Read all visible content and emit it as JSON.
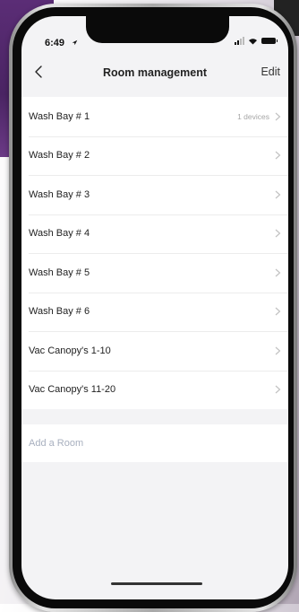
{
  "status_bar": {
    "time": "6:49"
  },
  "nav": {
    "title": "Room management",
    "edit_label": "Edit"
  },
  "rooms": [
    {
      "name": "Wash Bay # 1",
      "count": "1 devices"
    },
    {
      "name": "Wash Bay # 2",
      "count": ""
    },
    {
      "name": "Wash Bay # 3",
      "count": ""
    },
    {
      "name": "Wash Bay # 4",
      "count": ""
    },
    {
      "name": "Wash Bay # 5",
      "count": ""
    },
    {
      "name": "Wash Bay # 6",
      "count": ""
    },
    {
      "name": "Vac Canopy's 1-10",
      "count": ""
    },
    {
      "name": "Vac Canopy's 11-20",
      "count": ""
    }
  ],
  "add_room": {
    "label": "Add a Room"
  },
  "icons": {
    "back": "chevron-left-icon",
    "row_arrow": "chevron-right-icon",
    "location": "location-arrow-icon",
    "signal": "cellular-signal-icon",
    "wifi": "wifi-icon",
    "battery": "battery-icon"
  },
  "colors": {
    "accent_purple": "#5b2d76",
    "row_count_gray": "#a6a6a6",
    "add_room_text": "#a8b0bf",
    "screen_bg": "#f3f3f5"
  }
}
